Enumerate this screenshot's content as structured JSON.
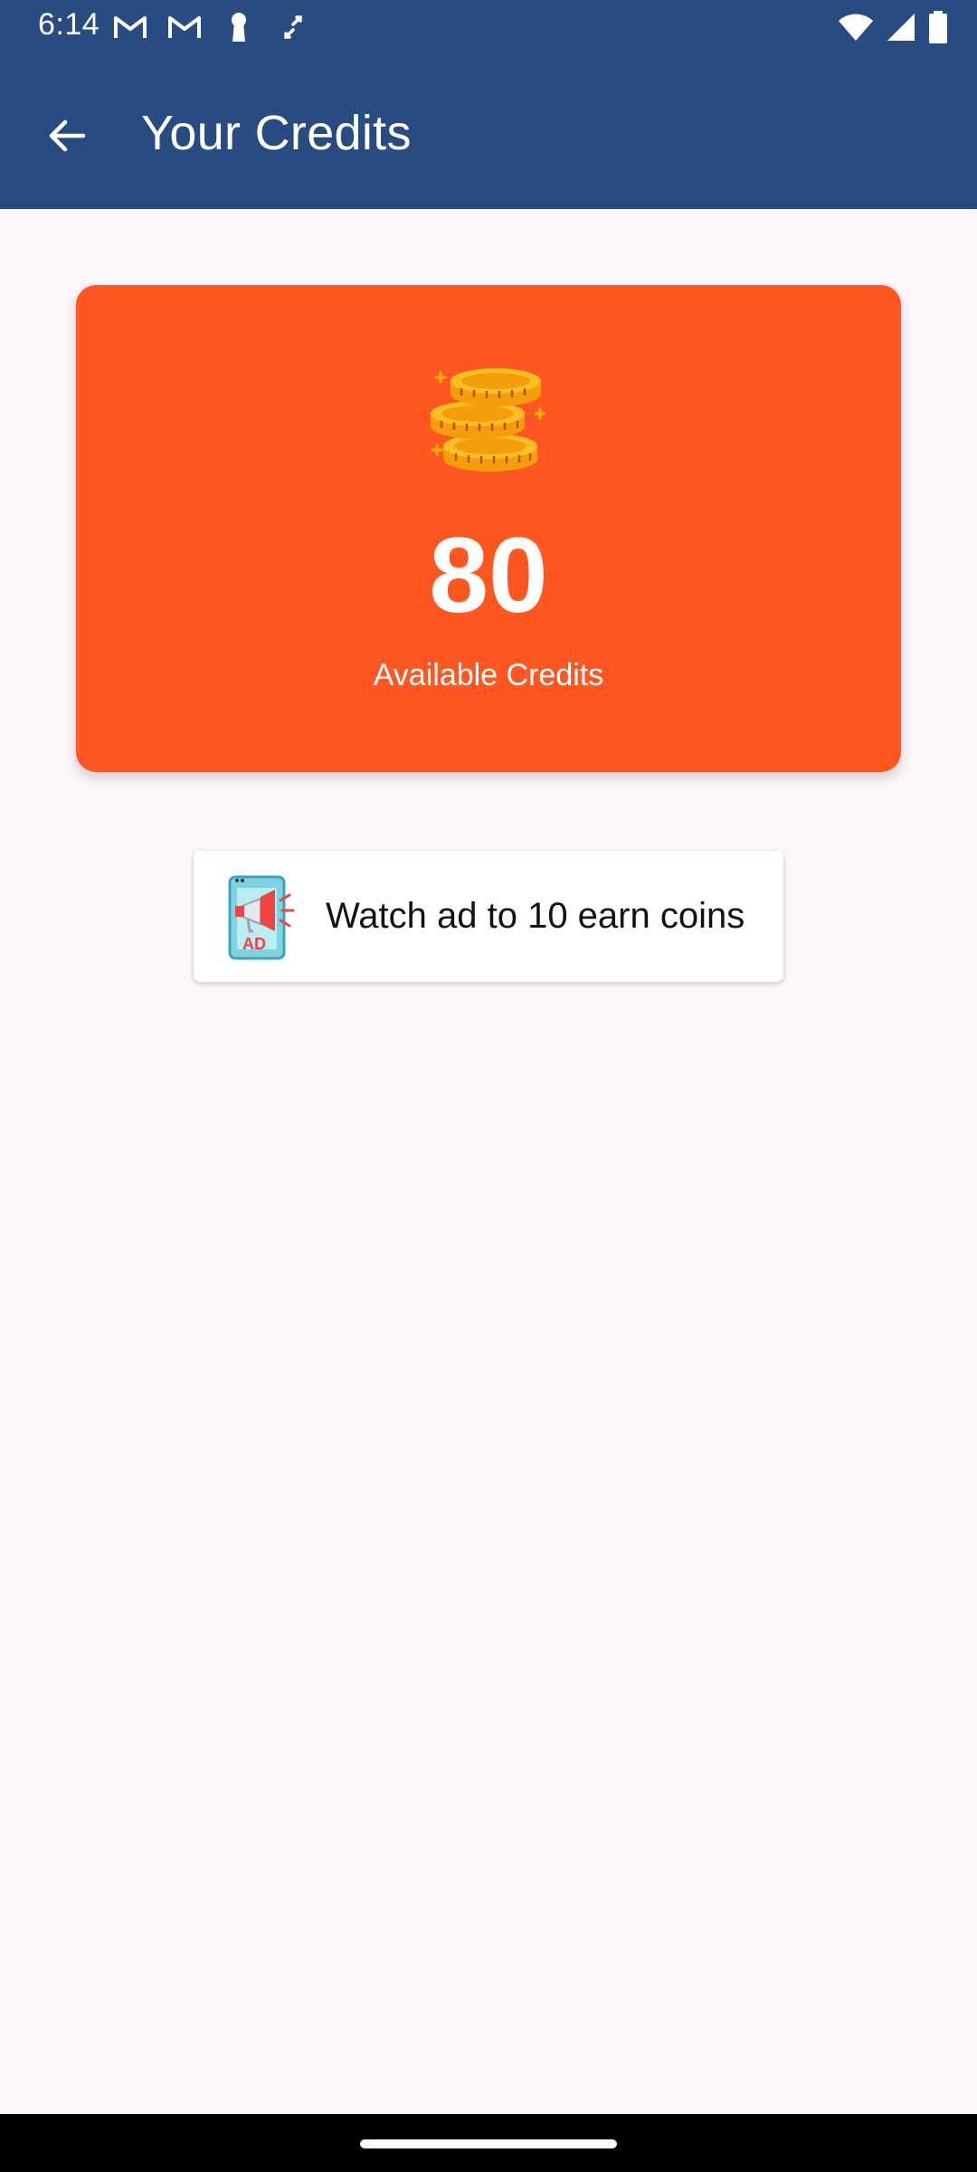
{
  "status_bar": {
    "time": "6:14",
    "left_icons": [
      "gmail-icon",
      "gmail-icon",
      "keyhole-icon",
      "sync-icon"
    ],
    "right_icons": [
      "wifi-icon",
      "signal-icon",
      "battery-icon"
    ]
  },
  "app_bar": {
    "title": "Your Credits",
    "back_icon": "arrow-back-icon",
    "color": "#284b82"
  },
  "credits": {
    "value": "80",
    "label": "Available Credits",
    "icon": "coins-icon",
    "card_color": "#ff5722"
  },
  "watch_ad": {
    "label": "Watch ad to 10 earn coins",
    "icon": "ad-megaphone-icon"
  }
}
